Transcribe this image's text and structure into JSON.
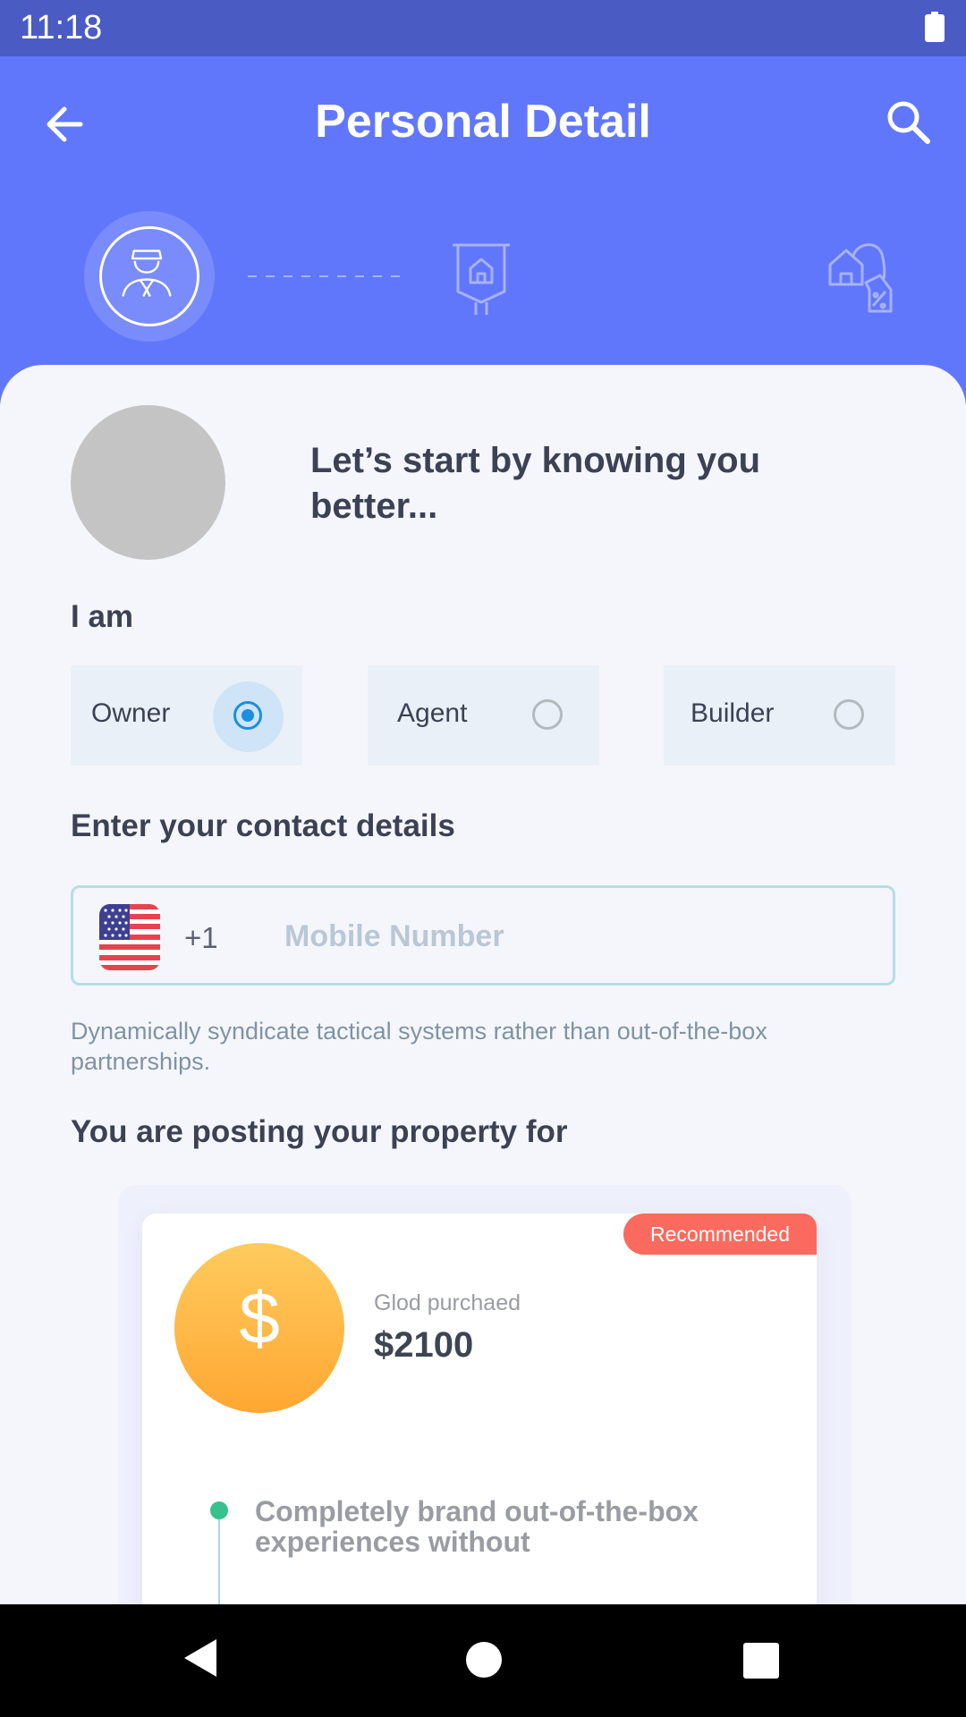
{
  "status_bar": {
    "time": "11:18",
    "battery_icon": "battery-full-icon"
  },
  "header": {
    "title": "Personal Detail",
    "back_icon": "arrow-left-icon",
    "search_icon": "search-icon",
    "steps": [
      "person-icon",
      "house-sign-icon",
      "house-price-tag-icon"
    ]
  },
  "intro": {
    "text": "Let’s start by knowing you better..."
  },
  "role": {
    "label": "I am",
    "options": [
      {
        "label": "Owner",
        "selected": true
      },
      {
        "label": "Agent",
        "selected": false
      },
      {
        "label": "Builder",
        "selected": false
      }
    ]
  },
  "contact": {
    "label": "Enter your contact details",
    "flag_icon": "us-flag-icon",
    "country_code": "+1",
    "placeholder": "Mobile Number",
    "value": "",
    "helper": "Dynamically syndicate tactical systems rather than out-of-the-box partnerships."
  },
  "posting": {
    "label": "You are posting your property for",
    "card": {
      "badge": "Recommended",
      "coin_symbol": "$",
      "subtitle": "Glod purchaed",
      "price": "$2100",
      "feature": "Completely brand out-of-the-box experiences without"
    }
  },
  "colors": {
    "header": "#6177fb",
    "status_bar": "#4a5bc4",
    "accent": "#1b8fe0",
    "badge": "#fb6a5e",
    "coin": "#ffb33d"
  }
}
